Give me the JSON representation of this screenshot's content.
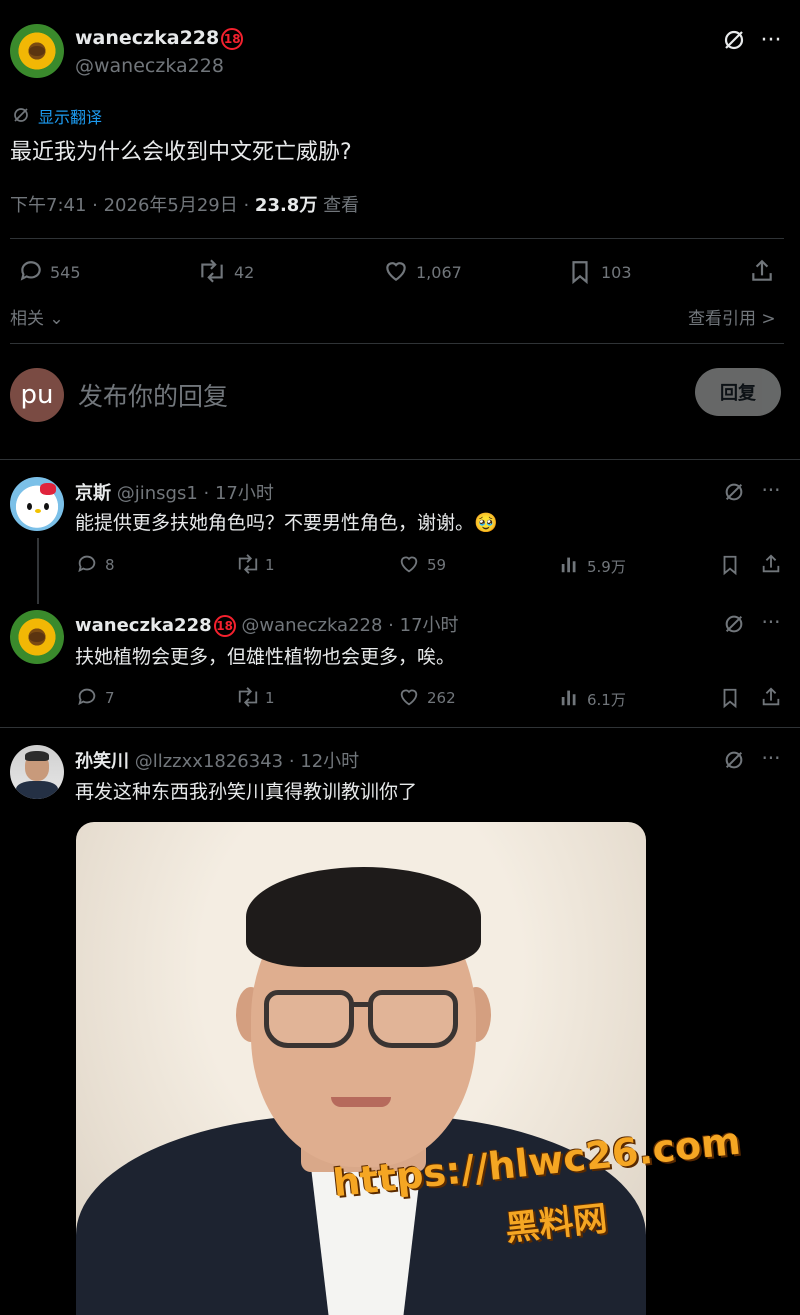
{
  "post": {
    "display_name": "waneczka228",
    "badge": "18",
    "handle": "@waneczka228",
    "translate_label": "显示翻译",
    "text": "最近我为什么会收到中文死亡威胁?",
    "time": "下午7:41 · 2026年5月29日 · ",
    "views": "23.8万",
    "views_label": " 查看",
    "stats": {
      "replies": "545",
      "reposts": "42",
      "likes": "1,067",
      "bookmarks": "103"
    },
    "related_label": "相关",
    "quotes_label": "查看引用 >"
  },
  "composer": {
    "avatar_text": "pu",
    "placeholder": "发布你的回复",
    "button_label": "回复"
  },
  "replies": [
    {
      "name": "京斯",
      "handle": "@jinsgs1 · 17小时",
      "text": "能提供更多扶她角色吗？不要男性角色，谢谢。🥹",
      "replies": "8",
      "reposts": "1",
      "likes": "59",
      "views": "5.9万"
    },
    {
      "name": "waneczka228",
      "badge": "18",
      "handle": "@waneczka228 · 17小时",
      "text": "扶她植物会更多，但雄性植物也会更多，唉。",
      "replies": "7",
      "reposts": "1",
      "likes": "262",
      "views": "6.1万"
    },
    {
      "name": "孙笑川",
      "handle": "@llzzxx1826343 · 12小时",
      "text": "再发这种东西我孙笑川真得教训教训你了"
    }
  ],
  "watermark": {
    "url": "https://hlwc26.com",
    "name": "黑料网"
  }
}
